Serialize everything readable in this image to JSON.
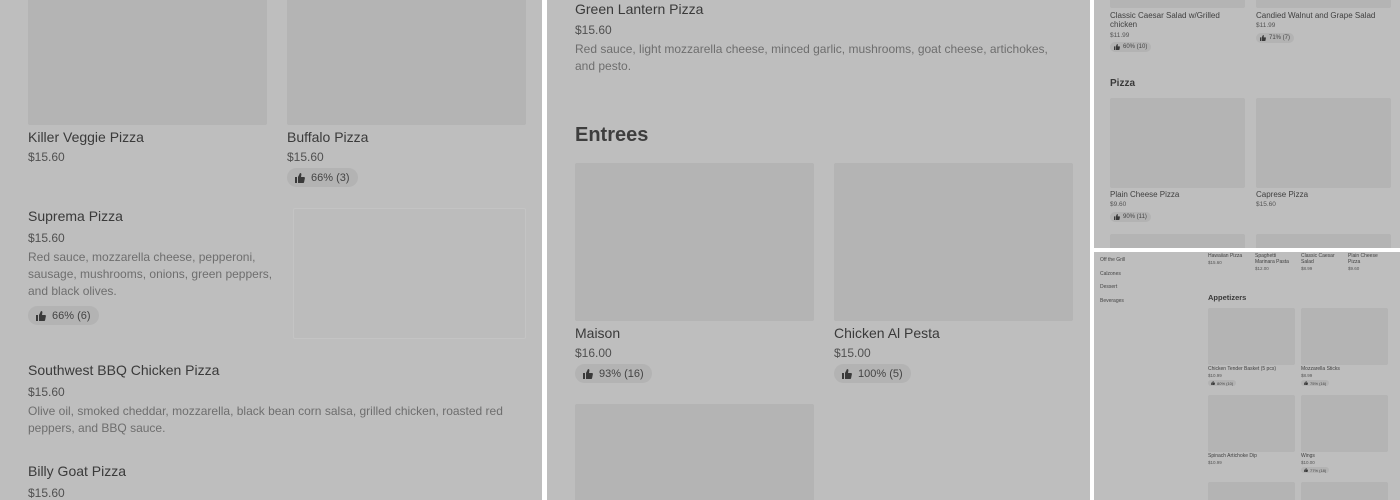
{
  "panel1": {
    "items": [
      {
        "name": "Killer Veggie Pizza",
        "price": "$15.60"
      },
      {
        "name": "Buffalo Pizza",
        "price": "$15.60",
        "rating": "66% (3)"
      },
      {
        "name": "Suprema Pizza",
        "price": "$15.60",
        "description": "Red sauce, mozzarella cheese, pepperoni, sausage, mushrooms, onions, green peppers, and black olives.",
        "rating": "66% (6)"
      },
      {
        "name": "Southwest BBQ Chicken Pizza",
        "price": "$15.60",
        "description": "Olive oil, smoked cheddar, mozzarella, black bean corn salsa, grilled chicken, roasted red peppers, and BBQ sauce."
      },
      {
        "name": "Billy Goat Pizza",
        "price": "$15.60"
      }
    ]
  },
  "panel2": {
    "top_item": {
      "name": "Green Lantern Pizza",
      "price": "$15.60",
      "description": "Red sauce, light mozzarella cheese, minced garlic, mushrooms, goat cheese, artichokes, and pesto."
    },
    "section_title": "Entrees",
    "items": [
      {
        "name": "Maison",
        "price": "$16.00",
        "rating": "93% (16)"
      },
      {
        "name": "Chicken Al Pesta",
        "price": "$15.00",
        "rating": "100% (5)"
      }
    ]
  },
  "panel3": {
    "salads": [
      {
        "name": "Classic Caesar Salad w/Grilled chicken",
        "price": "$11.99",
        "rating": "60% (10)"
      },
      {
        "name": "Candied Walnut and Grape Salad",
        "price": "$11.99",
        "rating": "71% (7)"
      }
    ],
    "section_title": "Pizza",
    "pizzas": [
      {
        "name": "Plain Cheese Pizza",
        "price": "$9.60",
        "rating": "90% (11)"
      },
      {
        "name": "Caprese Pizza",
        "price": "$15.60"
      }
    ]
  },
  "panel4": {
    "nav": [
      "Off the Grill",
      "Calzones",
      "Dessert",
      "Beverages"
    ],
    "top_items": [
      {
        "name": "Hawaiian Pizza",
        "price": "$15.60"
      },
      {
        "name": "Spaghetti Marinara Pasta",
        "price": "$12.00"
      },
      {
        "name": "Classic Caesar Salad",
        "price": "$8.99"
      },
      {
        "name": "Plain Cheese Pizza",
        "price": "$9.60"
      }
    ],
    "section_title": "Appetizers",
    "items": [
      {
        "name": "Chicken Tender Basket (5 pcs)",
        "price": "$10.99",
        "rating": "80% (10)"
      },
      {
        "name": "Mozzarella Sticks",
        "price": "$8.99",
        "rating": "75% (16)"
      },
      {
        "name": "Spinach Artichoke Dip",
        "price": "$10.99"
      },
      {
        "name": "Wings",
        "price": "$10.00",
        "rating": "77% (18)"
      }
    ]
  },
  "colors": {
    "overlay": "#bebebe",
    "image_placeholder": "#b4b4b4",
    "text_dark": "#3a3a3a"
  },
  "icons": {
    "rating": "thumbs-up-icon"
  }
}
